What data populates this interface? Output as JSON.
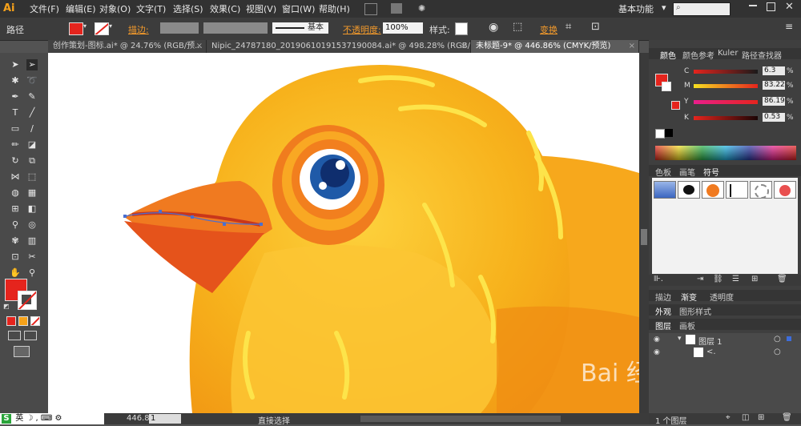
{
  "app": {
    "logo": "Ai"
  },
  "menu": [
    "文件(F)",
    "编辑(E)",
    "对象(O)",
    "文字(T)",
    "选择(S)",
    "效果(C)",
    "视图(V)",
    "窗口(W)",
    "帮助(H)"
  ],
  "workspace": {
    "label": "基本功能",
    "arrow": "▾"
  },
  "search": {
    "placeholder": ""
  },
  "control_bar": {
    "path_label": "路径",
    "stroke_label": "描边:",
    "stroke_style": "基本",
    "opacity_label": "不透明度:",
    "opacity_value": "100%",
    "style_label": "样式:",
    "transform_label": "变换",
    "fill_color": "#e5241d"
  },
  "tabs": [
    {
      "label": "创作策划-图标.ai* @ 24.76% (RGB/预..."
    },
    {
      "label": "Nipic_24787180_20190610191537190084.ai* @ 498.28% (RGB/预..."
    },
    {
      "label": "未标题-9* @ 446.86% (CMYK/预览)"
    }
  ],
  "color_panel": {
    "tabs": [
      "颜色",
      "颜色参考",
      "Kuler",
      "路径查找器"
    ],
    "channels": [
      {
        "name": "C",
        "value": "6.3",
        "unit": "%"
      },
      {
        "name": "M",
        "value": "83.22",
        "unit": "%"
      },
      {
        "name": "Y",
        "value": "86.19",
        "unit": "%"
      },
      {
        "name": "K",
        "value": "0.53",
        "unit": "%"
      }
    ],
    "fill_color": "#e5241d"
  },
  "swatch_panel": {
    "tabs": [
      "色板",
      "画笔",
      "符号"
    ]
  },
  "stroke_panel": {
    "tabs": [
      "描边",
      "渐变",
      "透明度"
    ]
  },
  "appearance_panel": {
    "tabs": [
      "外观",
      "图形样式"
    ]
  },
  "layers_panel": {
    "tabs": [
      "图层",
      "画板"
    ],
    "layers": [
      {
        "name": "图层 1"
      },
      {
        "name": "<."
      }
    ],
    "footer": "1 个图层"
  },
  "status": {
    "zoom": "446.86",
    "page": "1",
    "tool": "直接选择"
  },
  "ime": {
    "label": "英"
  }
}
